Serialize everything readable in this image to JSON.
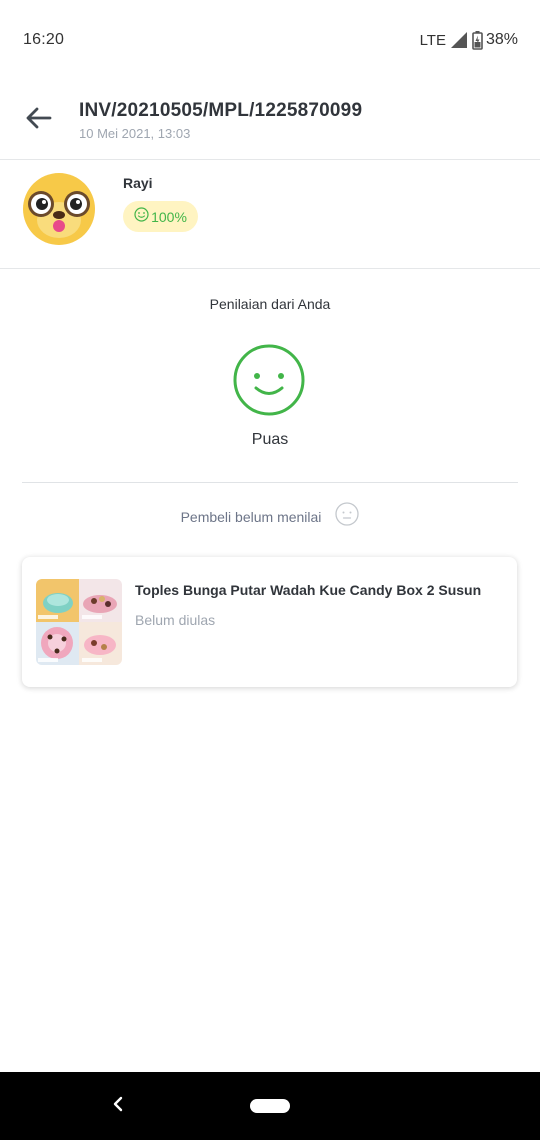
{
  "status_bar": {
    "time": "16:20",
    "network": "LTE",
    "battery": "38%"
  },
  "header": {
    "invoice_number": "INV/20210505/MPL/1225870099",
    "date": "10 Mei 2021, 13:03"
  },
  "buyer": {
    "name": "Rayi",
    "satisfaction": "100%"
  },
  "your_rating": {
    "label": "Penilaian dari Anda",
    "value": "Puas"
  },
  "buyer_rating_status": "Pembeli belum menilai",
  "product": {
    "name": "Toples Bunga Putar Wadah Kue Candy Box 2 Susun",
    "review_status": "Belum diulas"
  },
  "colors": {
    "accent_green": "#42b549",
    "badge_bg": "#fff4c2",
    "text_dark": "#31353b",
    "text_muted": "#9fa6b0"
  }
}
